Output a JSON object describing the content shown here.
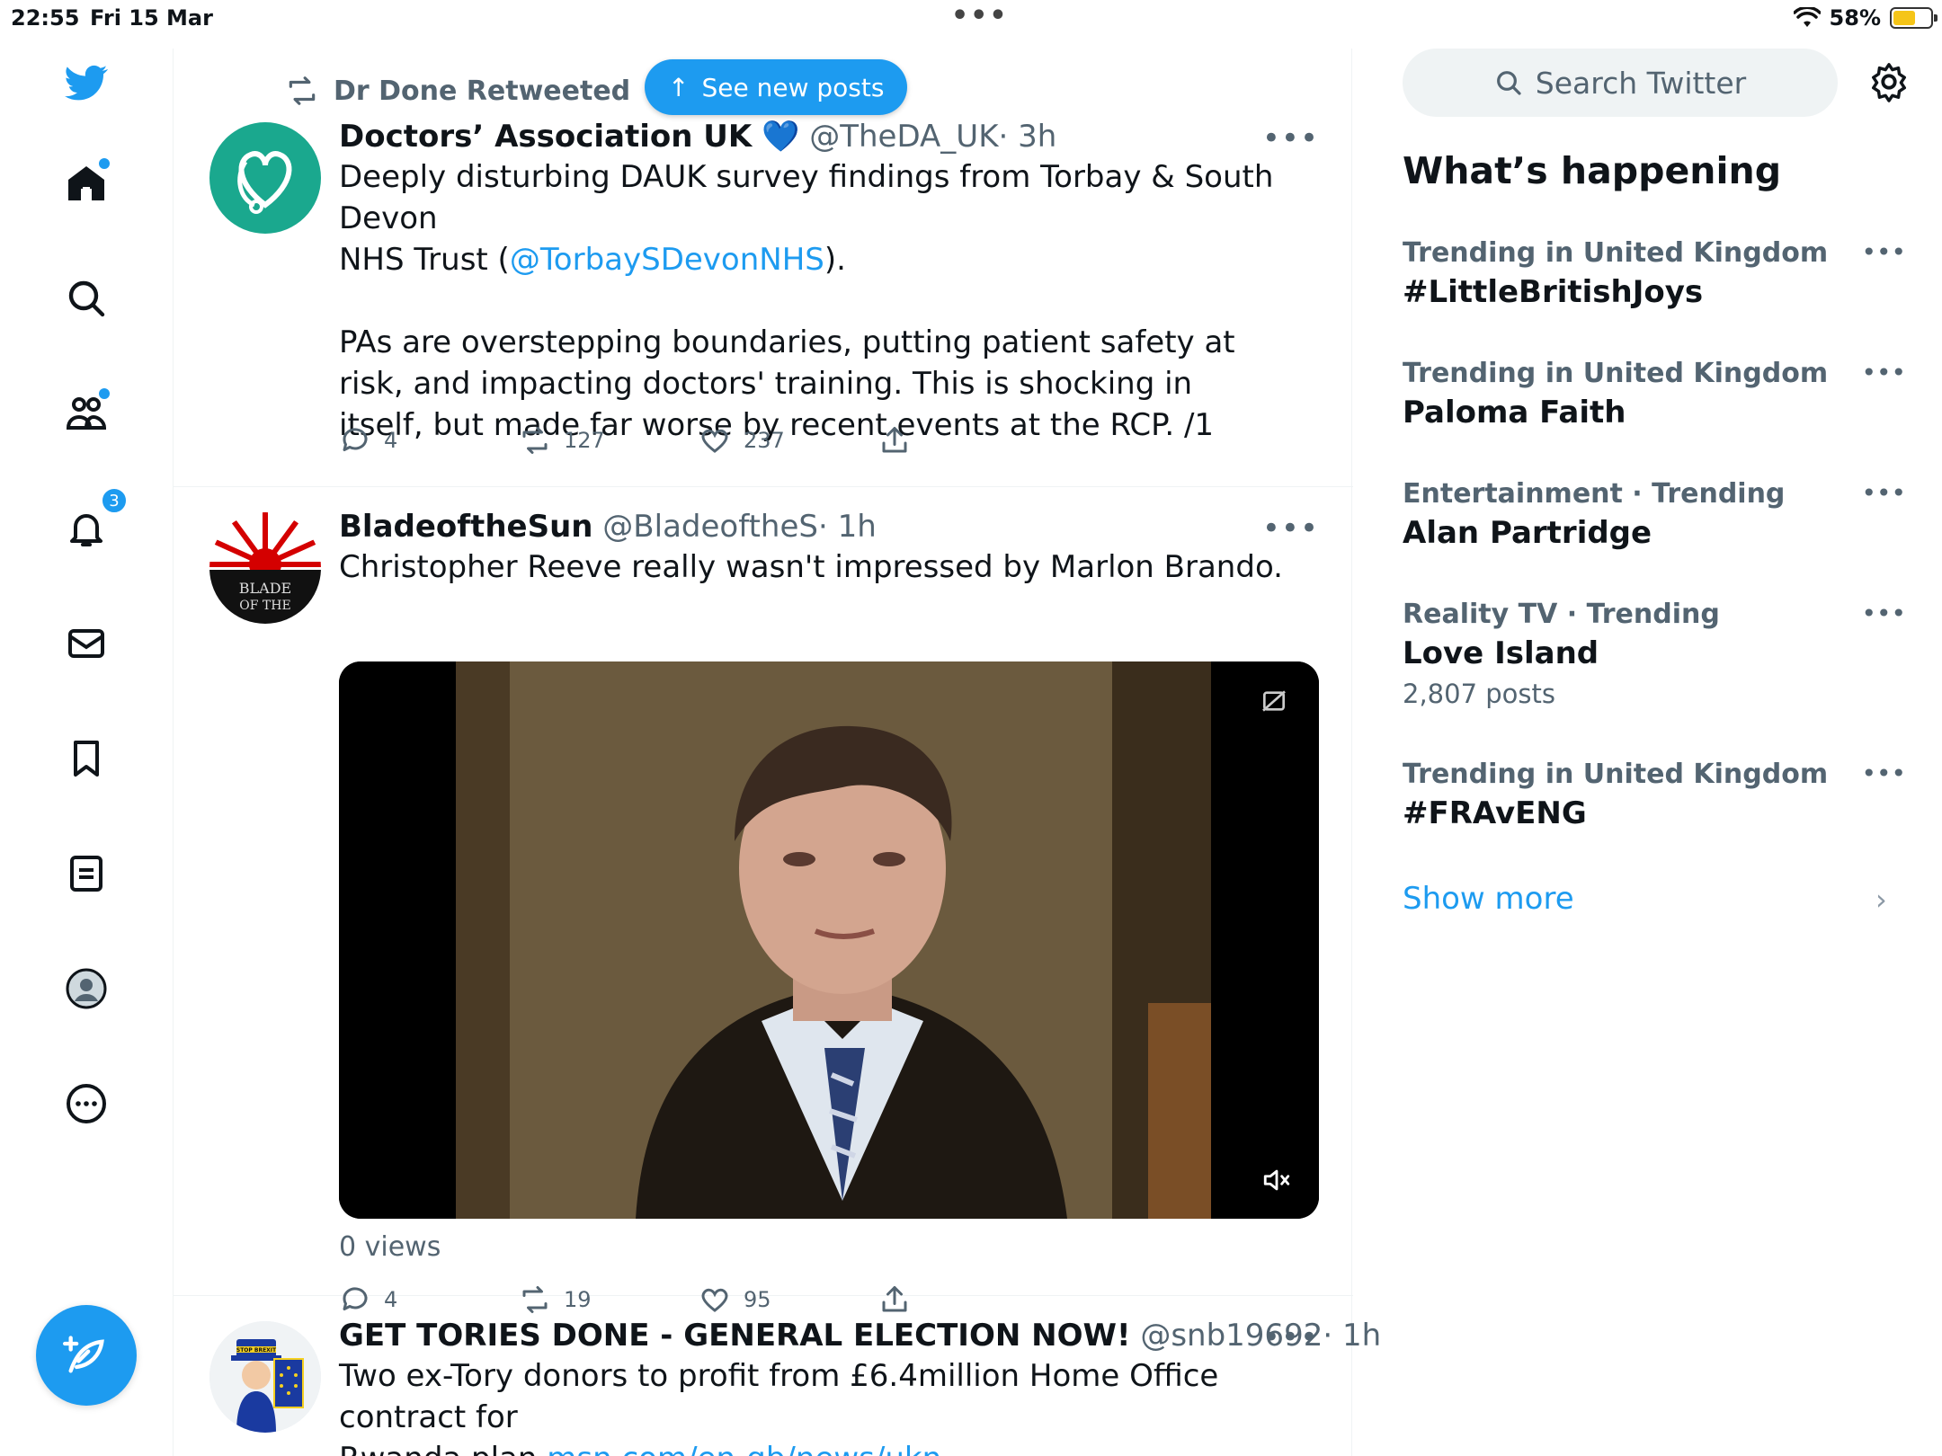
{
  "status_bar": {
    "time": "22:55",
    "date": "Fri 15 Mar",
    "battery": "58%"
  },
  "nav": {
    "notifications_count": "3"
  },
  "banner": {
    "see_new_posts": "See new posts"
  },
  "tweets": [
    {
      "retweeted_by": "Dr Done Retweeted",
      "name": "Doctors’ Association UK",
      "verified_emoji": "💙",
      "handle": "@TheDA_UK",
      "time": "· 3h",
      "text_line1": "Deeply disturbing DAUK survey findings from Torbay & South Devon",
      "text_line2_pre": "NHS Trust (",
      "mention": "@TorbaySDevonNHS",
      "text_line2_post": ").",
      "text_para2": "PAs are overstepping boundaries, putting patient safety at risk, and impacting doctors' training. This is shocking in itself, but made far worse by recent events at the RCP. /1",
      "replies": "4",
      "retweets": "127",
      "likes": "237"
    },
    {
      "name": "BladeoftheSun",
      "handle": "@BladeoftheS",
      "time": "· 1h",
      "text": "Christopher Reeve really wasn't impressed by Marlon Brando.",
      "avatar_text": "BLADE OF THE",
      "views": "0 views",
      "replies": "4",
      "retweets": "19",
      "likes": "95"
    },
    {
      "name": "GET TORIES DONE - GENERAL ELECTION NOW!",
      "handle": "@snb19692",
      "time": "· 1h",
      "text_line1": "Two ex-Tory donors to profit from £6.4million Home Office contract for",
      "text_line2_pre": "Rwanda plan ",
      "link": "msn.com/en-gb/news/ukn…",
      "avatar_text": "STOP BREXIT"
    }
  ],
  "sidebar": {
    "search_placeholder": "Search Twitter",
    "title": "What’s happening",
    "trends": [
      {
        "meta": "Trending in United Kingdom",
        "topic": "#LittleBritishJoys"
      },
      {
        "meta": "Trending in United Kingdom",
        "topic": "Paloma Faith"
      },
      {
        "meta": "Entertainment · Trending",
        "topic": "Alan Partridge"
      },
      {
        "meta": "Reality TV · Trending",
        "topic": "Love Island",
        "count": "2,807 posts"
      },
      {
        "meta": "Trending in United Kingdom",
        "topic": "#FRAvENG"
      }
    ],
    "show_more": "Show more"
  },
  "colors": {
    "accent": "#1d9bf0",
    "text": "#0f1419",
    "muted": "#536471",
    "divider": "#eff3f4",
    "battery": "#f5c518",
    "dauk_teal": "#1aa88e"
  }
}
